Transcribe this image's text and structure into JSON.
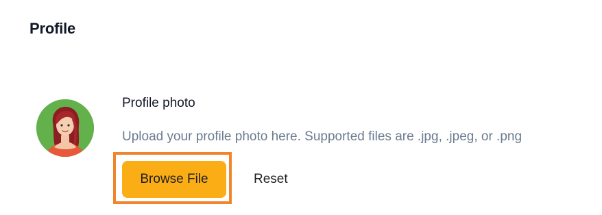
{
  "page": {
    "title": "Profile"
  },
  "profile_photo": {
    "heading": "Profile photo",
    "description": "Upload your profile photo here. Supported files are .jpg, .jpeg, or .png",
    "avatar_icon": "woman-avatar",
    "browse_label": "Browse File",
    "reset_label": "Reset"
  },
  "colors": {
    "accent": "#fbad16",
    "focus_outline": "#f0852c",
    "avatar_background": "#62b14a",
    "muted_text": "#6b7b8f"
  }
}
